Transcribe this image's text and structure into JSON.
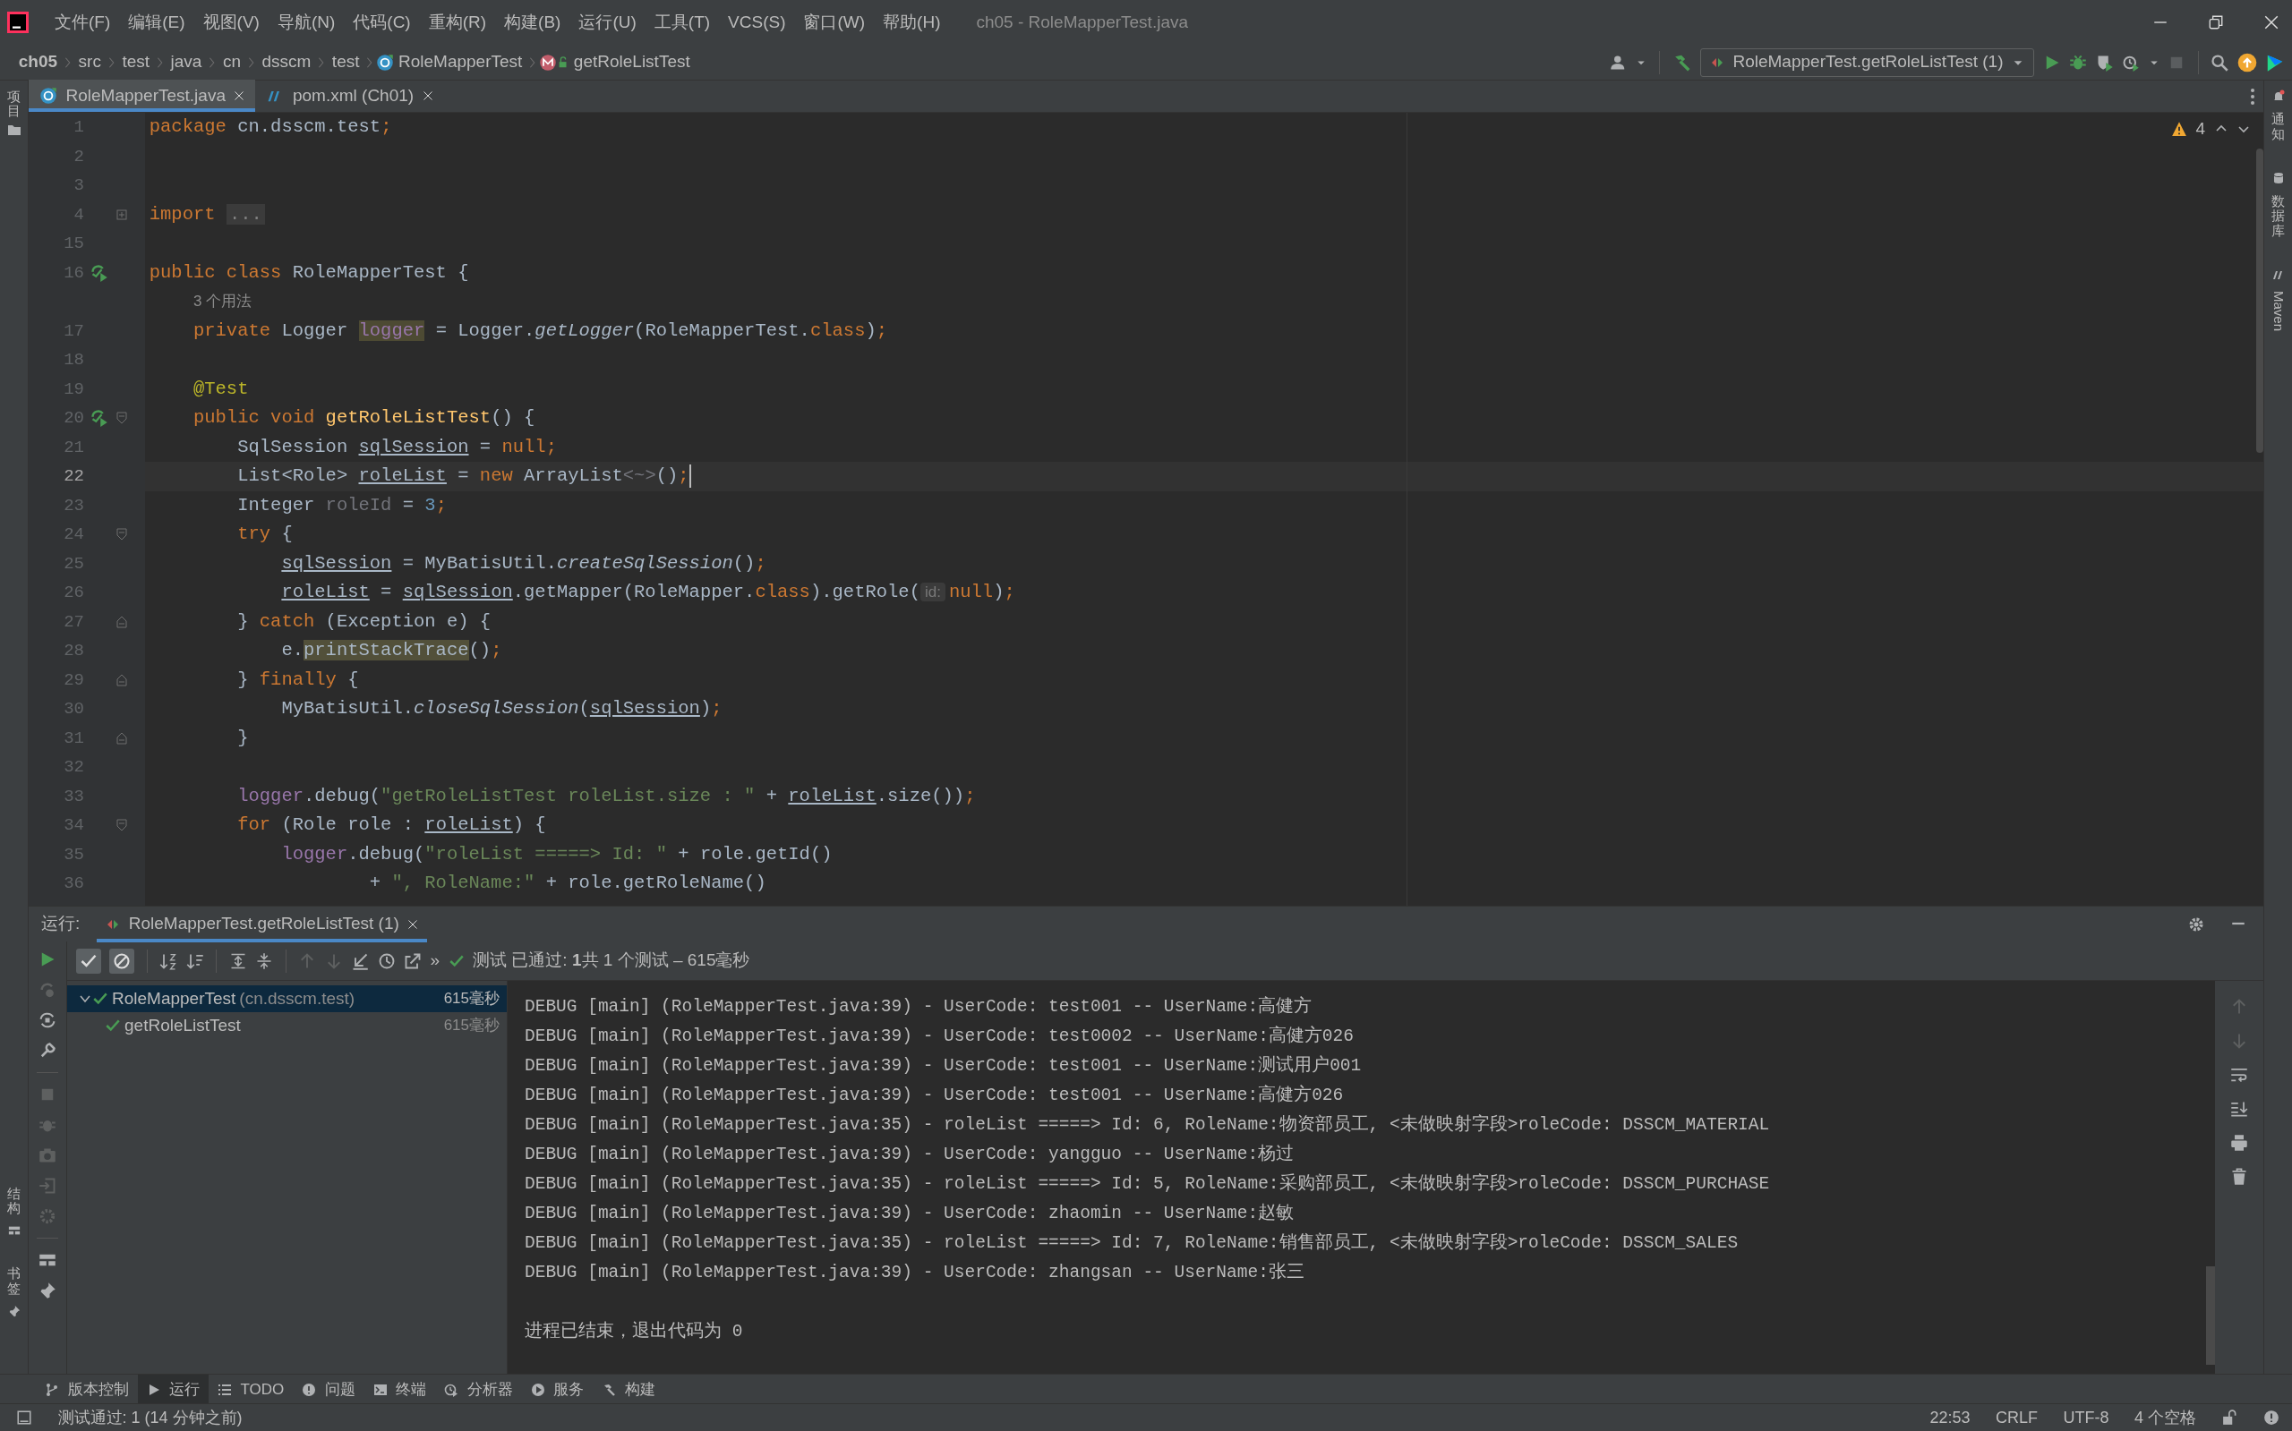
{
  "menu": [
    "文件(F)",
    "编辑(E)",
    "视图(V)",
    "导航(N)",
    "代码(C)",
    "重构(R)",
    "构建(B)",
    "运行(U)",
    "工具(T)",
    "VCS(S)",
    "窗口(W)",
    "帮助(H)"
  ],
  "window_title": "ch05 - RoleMapperTest.java",
  "breadcrumb": [
    {
      "label": "ch05",
      "kind": "project"
    },
    {
      "label": "src",
      "kind": "folder"
    },
    {
      "label": "test",
      "kind": "folder"
    },
    {
      "label": "java",
      "kind": "folder"
    },
    {
      "label": "cn",
      "kind": "folder"
    },
    {
      "label": "dsscm",
      "kind": "folder"
    },
    {
      "label": "test",
      "kind": "folder"
    },
    {
      "label": "RoleMapperTest",
      "kind": "class"
    },
    {
      "label": "getRoleListTest",
      "kind": "method"
    }
  ],
  "run_config": "RoleMapperTest.getRoleListTest (1)",
  "editor_tabs": [
    {
      "label": "RoleMapperTest.java",
      "kind": "class",
      "selected": true
    },
    {
      "label": "pom.xml (Ch01)",
      "kind": "maven",
      "selected": false
    }
  ],
  "left_strip": {
    "top": "项目",
    "bottom": [
      "结构",
      "书签"
    ]
  },
  "right_strip": [
    "通知",
    "数据库",
    "Maven"
  ],
  "warnings": "4",
  "code_lines": [
    {
      "num": "1",
      "tokens": [
        {
          "t": "package",
          "kind": "kw"
        },
        {
          "t": " cn.dsscm.test",
          "kind": "plain"
        },
        {
          "t": ";",
          "kind": "kw"
        }
      ]
    },
    {
      "num": "2"
    },
    {
      "num": "3"
    },
    {
      "num": "4",
      "fold": {
        "kind": "collapsed"
      },
      "tokens": [
        {
          "t": "import ",
          "kind": "kw"
        },
        {
          "t": "...",
          "kind": "folded"
        }
      ]
    },
    {
      "num": "15"
    },
    {
      "num": "16",
      "run_marker": true,
      "tokens": [
        {
          "t": "public class ",
          "kind": "kw"
        },
        {
          "t": "RoleMapperTest {",
          "kind": "plain"
        }
      ]
    },
    {
      "tokens": [
        {
          "t": "    3 个用法",
          "kind": "usages"
        }
      ]
    },
    {
      "num": "17",
      "tokens": [
        {
          "t": "    private ",
          "kind": "kw"
        },
        {
          "t": "Logger ",
          "kind": "plain"
        },
        {
          "t": "logger",
          "kind": "field-hl"
        },
        {
          "t": " = Logger.",
          "kind": "plain"
        },
        {
          "t": "getLogger",
          "kind": "static"
        },
        {
          "t": "(RoleMapperTest.",
          "kind": "plain"
        },
        {
          "t": "class",
          "kind": "kw"
        },
        {
          "t": ")",
          "kind": "plain"
        },
        {
          "t": ";",
          "kind": "kw"
        }
      ]
    },
    {
      "num": "18"
    },
    {
      "num": "19",
      "tokens": [
        {
          "t": "    @Test",
          "kind": "annotation"
        }
      ]
    },
    {
      "num": "20",
      "run_marker": true,
      "fold": {
        "kind": "open"
      },
      "tokens": [
        {
          "t": "    public void ",
          "kind": "kw"
        },
        {
          "t": "getRoleListTest",
          "kind": "decl"
        },
        {
          "t": "() {",
          "kind": "plain"
        }
      ]
    },
    {
      "num": "21",
      "tokens": [
        {
          "t": "        SqlSession ",
          "kind": "plain"
        },
        {
          "t": "sqlSession",
          "kind": "reassigned"
        },
        {
          "t": " = ",
          "kind": "plain"
        },
        {
          "t": "null;",
          "kind": "kw"
        }
      ]
    },
    {
      "num": "22",
      "current": true,
      "tokens": [
        {
          "t": "        List<Role> ",
          "kind": "plain"
        },
        {
          "t": "roleList",
          "kind": "reassigned"
        },
        {
          "t": " = ",
          "kind": "plain"
        },
        {
          "t": "new ",
          "kind": "kw"
        },
        {
          "t": "ArrayList",
          "kind": "plain"
        },
        {
          "t": "<~>",
          "kind": "unused"
        },
        {
          "t": "()",
          "kind": "plain"
        },
        {
          "t": ";",
          "kind": "kw"
        }
      ]
    },
    {
      "num": "23",
      "tokens": [
        {
          "t": "        Integer ",
          "kind": "plain"
        },
        {
          "t": "roleId",
          "kind": "unused"
        },
        {
          "t": " = ",
          "kind": "plain"
        },
        {
          "t": "3",
          "kind": "number"
        },
        {
          "t": ";",
          "kind": "kw"
        }
      ]
    },
    {
      "num": "24",
      "fold": {
        "kind": "open"
      },
      "tokens": [
        {
          "t": "        try ",
          "kind": "kw"
        },
        {
          "t": "{",
          "kind": "plain"
        }
      ]
    },
    {
      "num": "25",
      "tokens": [
        {
          "t": "            sqlSession",
          "kind": "reassigned"
        },
        {
          "t": " = MyBatisUtil.",
          "kind": "plain"
        },
        {
          "t": "createSqlSession",
          "kind": "static"
        },
        {
          "t": "()",
          "kind": "plain"
        },
        {
          "t": ";",
          "kind": "kw"
        }
      ]
    },
    {
      "num": "26",
      "tokens": [
        {
          "t": "            roleList",
          "kind": "reassigned"
        },
        {
          "t": " = ",
          "kind": "plain"
        },
        {
          "t": "sqlSession",
          "kind": "reassigned"
        },
        {
          "t": ".getMapper(RoleMapper.",
          "kind": "plain"
        },
        {
          "t": "class",
          "kind": "kw"
        },
        {
          "t": ").getRole(",
          "kind": "plain"
        },
        {
          "t": "id:",
          "kind": "hint"
        },
        {
          "t": "null",
          "kind": "kw"
        },
        {
          "t": ")",
          "kind": "plain"
        },
        {
          "t": ";",
          "kind": "kw"
        }
      ]
    },
    {
      "num": "27",
      "fold": {
        "kind": "close"
      },
      "tokens": [
        {
          "t": "        } ",
          "kind": "plain"
        },
        {
          "t": "catch ",
          "kind": "kw"
        },
        {
          "t": "(Exception e) {",
          "kind": "plain"
        }
      ]
    },
    {
      "num": "28",
      "tokens": [
        {
          "t": "            e.",
          "kind": "plain"
        },
        {
          "t": "printStackTrace",
          "kind": "warn-hl"
        },
        {
          "t": "()",
          "kind": "plain"
        },
        {
          "t": ";",
          "kind": "kw"
        }
      ]
    },
    {
      "num": "29",
      "fold": {
        "kind": "close"
      },
      "tokens": [
        {
          "t": "        } ",
          "kind": "plain"
        },
        {
          "t": "finally ",
          "kind": "kw"
        },
        {
          "t": "{",
          "kind": "plain"
        }
      ]
    },
    {
      "num": "30",
      "tokens": [
        {
          "t": "            MyBatisUtil.",
          "kind": "plain"
        },
        {
          "t": "closeSqlSession",
          "kind": "static"
        },
        {
          "t": "(",
          "kind": "plain"
        },
        {
          "t": "sqlSession",
          "kind": "reassigned"
        },
        {
          "t": ")",
          "kind": "plain"
        },
        {
          "t": ";",
          "kind": "kw"
        }
      ]
    },
    {
      "num": "31",
      "fold": {
        "kind": "close"
      },
      "tokens": [
        {
          "t": "        }",
          "kind": "plain"
        }
      ]
    },
    {
      "num": "32"
    },
    {
      "num": "33",
      "tokens": [
        {
          "t": "        logger",
          "kind": "field"
        },
        {
          "t": ".debug(",
          "kind": "plain"
        },
        {
          "t": "\"getRoleListTest roleList.size : \"",
          "kind": "string"
        },
        {
          "t": " + ",
          "kind": "plain"
        },
        {
          "t": "roleList",
          "kind": "reassigned"
        },
        {
          "t": ".size())",
          "kind": "plain"
        },
        {
          "t": ";",
          "kind": "kw"
        }
      ]
    },
    {
      "num": "34",
      "fold": {
        "kind": "open"
      },
      "tokens": [
        {
          "t": "        for ",
          "kind": "kw"
        },
        {
          "t": "(Role role : ",
          "kind": "plain"
        },
        {
          "t": "roleList",
          "kind": "reassigned"
        },
        {
          "t": ") {",
          "kind": "plain"
        }
      ]
    },
    {
      "num": "35",
      "tokens": [
        {
          "t": "            logger",
          "kind": "field"
        },
        {
          "t": ".debug(",
          "kind": "plain"
        },
        {
          "t": "\"roleList =====> Id: \"",
          "kind": "string"
        },
        {
          "t": " + role.getId()",
          "kind": "plain"
        }
      ]
    },
    {
      "num": "36",
      "tokens": [
        {
          "t": "                    + ",
          "kind": "plain"
        },
        {
          "t": "\", RoleName:\"",
          "kind": "string"
        },
        {
          "t": " + role.getRoleName()",
          "kind": "plain"
        }
      ]
    }
  ],
  "run_panel": {
    "label": "运行:",
    "tab": "RoleMapperTest.getRoleListTest (1)",
    "toggles": [
      {
        "kind": "passed",
        "selected": true
      },
      {
        "kind": "ignored",
        "selected": true
      }
    ],
    "overflow": "»",
    "status": "测试 已通过: **1**共 1 个测试 – 615毫秒",
    "tree": [
      {
        "label": "RoleMapperTest",
        "detail": "(cn.dsscm.test)",
        "time": "615毫秒",
        "expanded": true,
        "selected": true,
        "children": [
          {
            "label": "getRoleListTest",
            "time": "615毫秒",
            "selected": false
          }
        ]
      }
    ],
    "console": [
      "DEBUG [main] (RoleMapperTest.java:39) - UserCode: test001 -- UserName:高健方",
      "DEBUG [main] (RoleMapperTest.java:39) - UserCode: test0002 -- UserName:高健方026",
      "DEBUG [main] (RoleMapperTest.java:39) - UserCode: test001 -- UserName:测试用户001",
      "DEBUG [main] (RoleMapperTest.java:39) - UserCode: test001 -- UserName:高健方026",
      "DEBUG [main] (RoleMapperTest.java:35) - roleList =====> Id: 6, RoleName:物资部员工, <未做映射字段>roleCode: DSSCM_MATERIAL",
      "DEBUG [main] (RoleMapperTest.java:39) - UserCode: yangguo -- UserName:杨过",
      "DEBUG [main] (RoleMapperTest.java:35) - roleList =====> Id: 5, RoleName:采购部员工, <未做映射字段>roleCode: DSSCM_PURCHASE",
      "DEBUG [main] (RoleMapperTest.java:39) - UserCode: zhaomin -- UserName:赵敏",
      "DEBUG [main] (RoleMapperTest.java:35) - roleList =====> Id: 7, RoleName:销售部员工, <未做映射字段>roleCode: DSSCM_SALES",
      "DEBUG [main] (RoleMapperTest.java:39) - UserCode: zhangsan -- UserName:张三"
    ],
    "exit": "进程已结束，退出代码为 0"
  },
  "tool_tabs": [
    {
      "label": "版本控制",
      "kind": "vcs",
      "selected": false
    },
    {
      "label": "运行",
      "kind": "run",
      "selected": true
    },
    {
      "label": "TODO",
      "kind": "todo",
      "selected": false
    },
    {
      "label": "问题",
      "kind": "problems",
      "selected": false
    },
    {
      "label": "终端",
      "kind": "terminal",
      "selected": false
    },
    {
      "label": "分析器",
      "kind": "profiler",
      "selected": false
    },
    {
      "label": "服务",
      "kind": "services",
      "selected": false
    },
    {
      "label": "构建",
      "kind": "build",
      "selected": false
    }
  ],
  "status_bar": {
    "message": "测试通过: 1 (14 分钟之前)",
    "items": [
      "22:53",
      "CRLF",
      "UTF-8",
      "4 个空格"
    ]
  }
}
